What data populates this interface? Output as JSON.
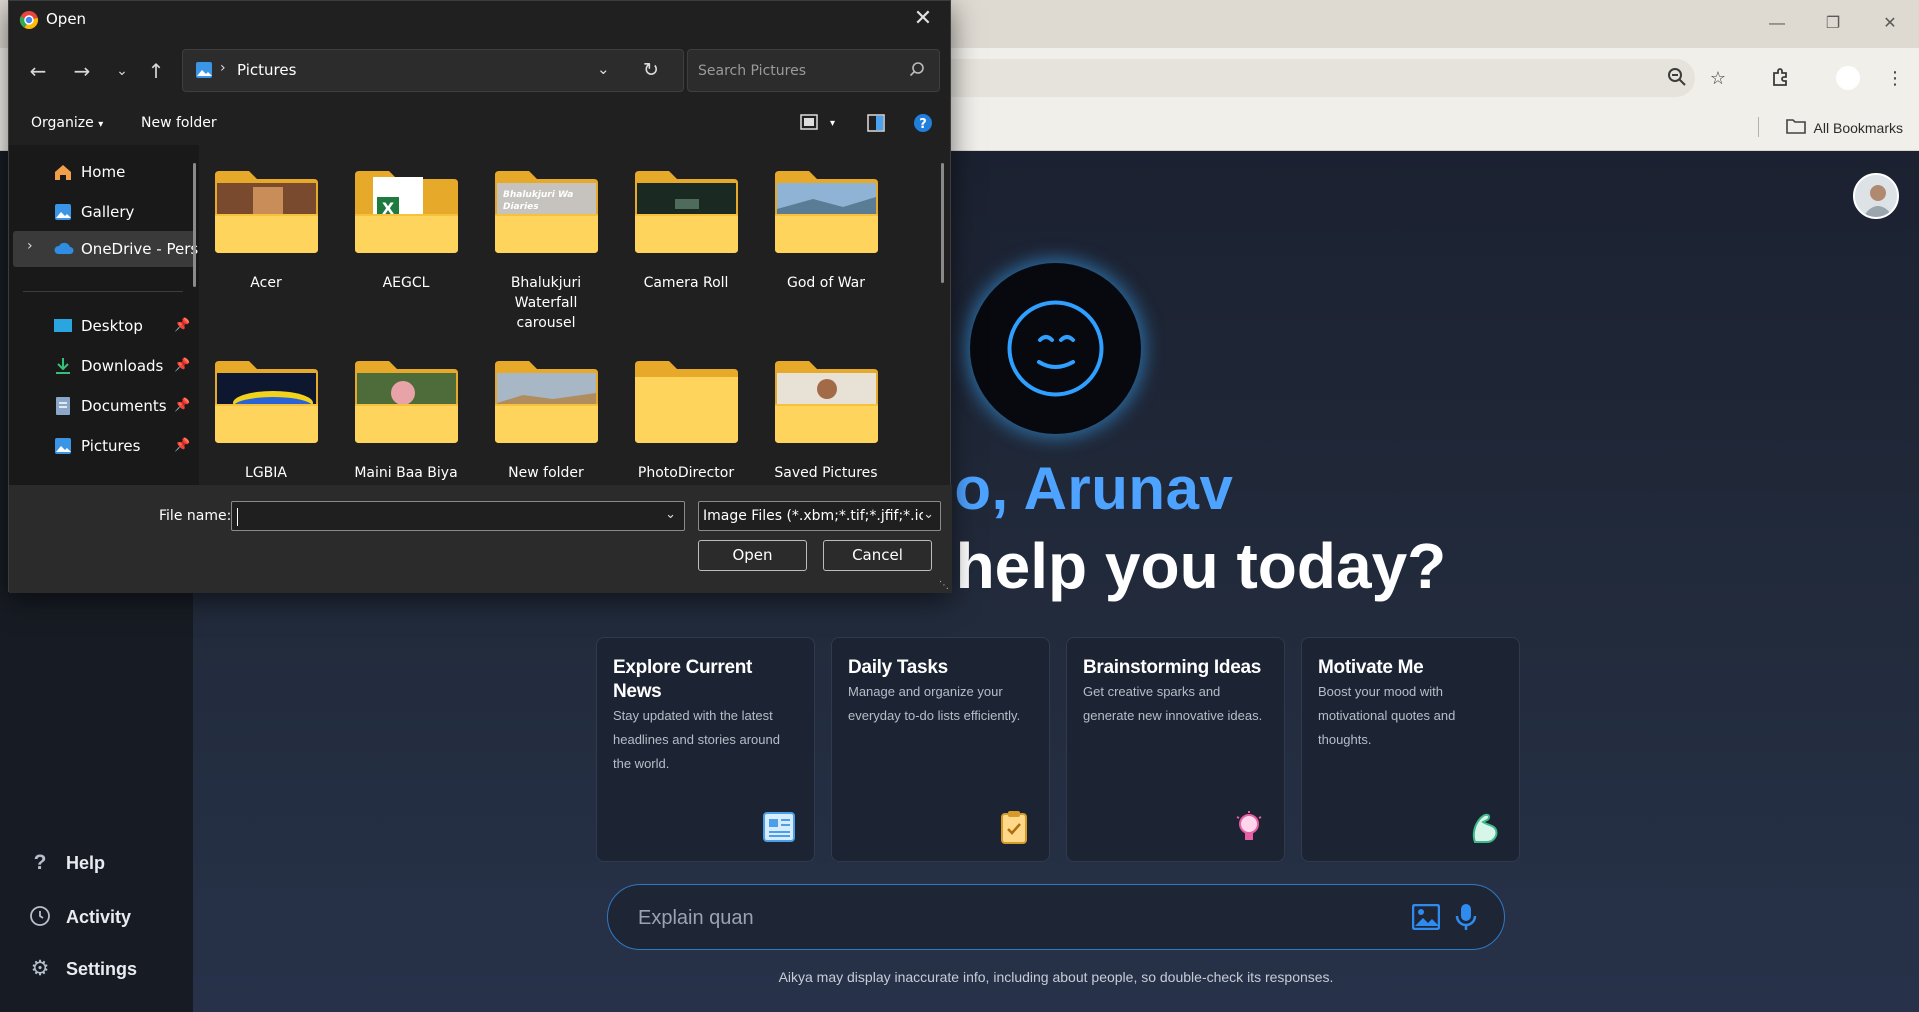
{
  "browser": {
    "bookmarks_label": "All Bookmarks"
  },
  "app": {
    "greeting": "llo, Arunav",
    "question": "l help you today?",
    "sidebar": [
      {
        "label": "Help",
        "icon": "question-icon"
      },
      {
        "label": "Activity",
        "icon": "history-icon"
      },
      {
        "label": "Settings",
        "icon": "gear-icon"
      }
    ],
    "cards": [
      {
        "title": "Explore Current News",
        "desc": "Stay updated with the latest headlines and stories around the world.",
        "icon": "newspaper-icon"
      },
      {
        "title": "Daily Tasks",
        "desc": "Manage and organize your everyday to-do lists efficiently.",
        "icon": "clipboard-icon"
      },
      {
        "title": "Brainstorming Ideas",
        "desc": "Get creative sparks and generate new innovative ideas.",
        "icon": "lightbulb-icon"
      },
      {
        "title": "Motivate Me",
        "desc": "Boost your mood with motivational quotes and thoughts.",
        "icon": "flexed-arm-icon"
      }
    ],
    "chat_input_value": "Explain quan",
    "disclaimer": "Aikya may display inaccurate info, including about people, so double-check its responses."
  },
  "dialog": {
    "title": "Open",
    "address": "Pictures",
    "search_placeholder": "Search Pictures",
    "organize_label": "Organize",
    "new_folder_label": "New folder",
    "nav": {
      "home": "Home",
      "gallery": "Gallery",
      "onedrive": "OneDrive - Perso",
      "desktop": "Desktop",
      "downloads": "Downloads",
      "documents": "Documents",
      "pictures": "Pictures"
    },
    "folders": [
      "Acer",
      "AEGCL",
      "Bhalukjuri Waterfall carousel",
      "Camera Roll",
      "God of War",
      "LGBIA",
      "Maini Baa Biya",
      "New folder",
      "PhotoDirector",
      "Saved Pictures"
    ],
    "folder_thumb_text": "Bhalukjuri Wa Diaries",
    "file_name_label": "File name:",
    "file_name_value": "",
    "file_type": "Image Files (*.xbm;*.tif;*.jfif;*.icc",
    "open_label": "Open",
    "cancel_label": "Cancel"
  }
}
